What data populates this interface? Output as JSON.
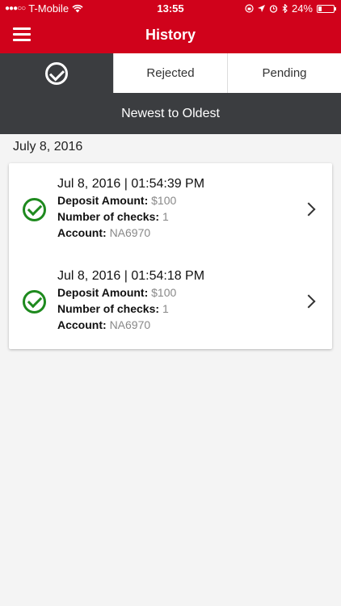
{
  "status_bar": {
    "carrier": "T-Mobile",
    "time": "13:55",
    "battery_percent": "24%",
    "battery_level": 0.24,
    "icons": [
      "signal-dots-icon",
      "wifi-icon",
      "lock-rotation-icon",
      "location-icon",
      "alarm-icon",
      "bluetooth-icon",
      "battery-icon"
    ]
  },
  "app_bar": {
    "title": "History",
    "menu_icon": "hamburger-icon",
    "background": "#d0021b"
  },
  "tabs": [
    {
      "label": "",
      "icon": "check-circle-icon",
      "active": true
    },
    {
      "label": "Rejected",
      "active": false
    },
    {
      "label": "Pending",
      "active": false
    }
  ],
  "sort": {
    "label": "Newest to Oldest"
  },
  "group": {
    "date": "July 8, 2016",
    "items": [
      {
        "timestamp": "Jul 8, 2016 | 01:54:39 PM",
        "deposit_label": "Deposit Amount:",
        "deposit_value": "$100",
        "checks_label": "Number of checks:",
        "checks_value": "1",
        "account_label": "Account:",
        "account_value": "NA6970",
        "status_icon": "check-circle-icon"
      },
      {
        "timestamp": "Jul 8, 2016 | 01:54:18 PM",
        "deposit_label": "Deposit Amount:",
        "deposit_value": "$100",
        "checks_label": "Number of checks:",
        "checks_value": "1",
        "account_label": "Account:",
        "account_value": "NA6970",
        "status_icon": "check-circle-icon"
      }
    ]
  },
  "colors": {
    "accent": "#d0021b",
    "dark": "#3b3d40",
    "success": "#1e8a1e"
  }
}
